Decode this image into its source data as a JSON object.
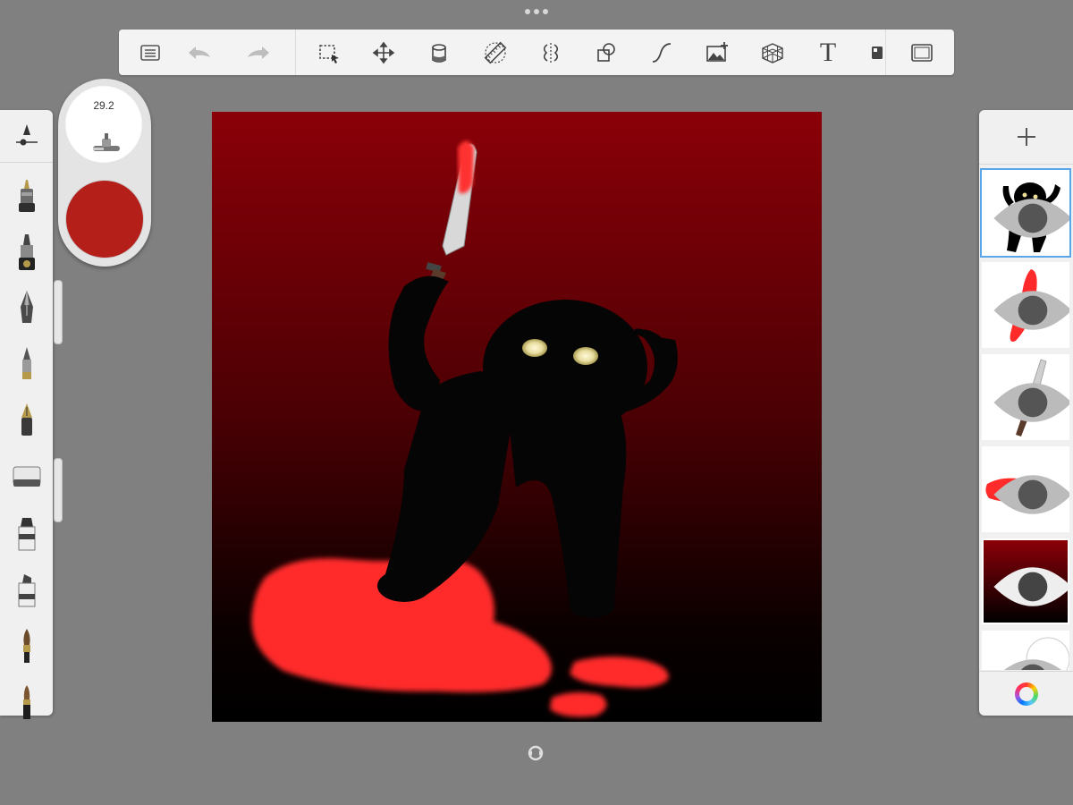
{
  "brush_size": {
    "value": "29.2"
  },
  "current_color": "#b41f1a",
  "toolbar": {
    "items": [
      "list-icon",
      "undo-icon",
      "redo-icon",
      "selection-icon",
      "transform-icon",
      "fill-icon",
      "ruler-icon",
      "symmetry-icon",
      "shape-icon",
      "stroke-icon",
      "image-add-icon",
      "perspective-grid-icon",
      "text-icon",
      "canvas-icon",
      "fullscreen-icon"
    ],
    "text_tool_label": "T"
  },
  "brushes": [
    "airbrush",
    "technical-pen",
    "ballpoint",
    "pencil",
    "fountain-pen",
    "eraser",
    "marker",
    "chisel-marker",
    "paint-brush",
    "ink-brush"
  ],
  "layers": [
    {
      "name": "cat",
      "visible": true,
      "selected": true
    },
    {
      "name": "blood-drip",
      "visible": true
    },
    {
      "name": "knife",
      "visible": true
    },
    {
      "name": "blood-pool",
      "visible": true
    },
    {
      "name": "background-gradient",
      "visible": true
    },
    {
      "name": "paper",
      "visible": true
    }
  ],
  "colors": {
    "toolbar_bg": "#f3f3f3",
    "workspace_bg": "#808080",
    "selection_blue": "#5aa6e8",
    "canvas_top": "#8b0008",
    "canvas_bottom": "#000000",
    "blood": "#ff3030"
  }
}
